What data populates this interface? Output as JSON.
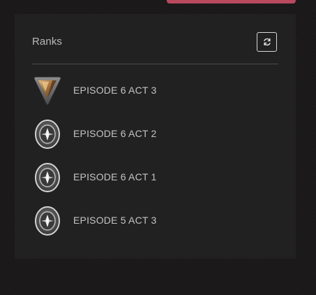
{
  "card": {
    "title": "Ranks",
    "refresh_icon": "refresh-icon"
  },
  "ranks": [
    {
      "label": "EPISODE 6 ACT 3",
      "icon": "triangle-rank-icon"
    },
    {
      "label": "EPISODE 6 ACT 2",
      "icon": "silver-rank-icon"
    },
    {
      "label": "EPISODE 6 ACT 1",
      "icon": "silver-rank-icon"
    },
    {
      "label": "EPISODE 5 ACT 3",
      "icon": "silver-rank-icon"
    }
  ],
  "colors": {
    "background": "#1a1818",
    "card": "#222121",
    "accent_button": "#b8495f",
    "text": "#c4c4c4"
  }
}
